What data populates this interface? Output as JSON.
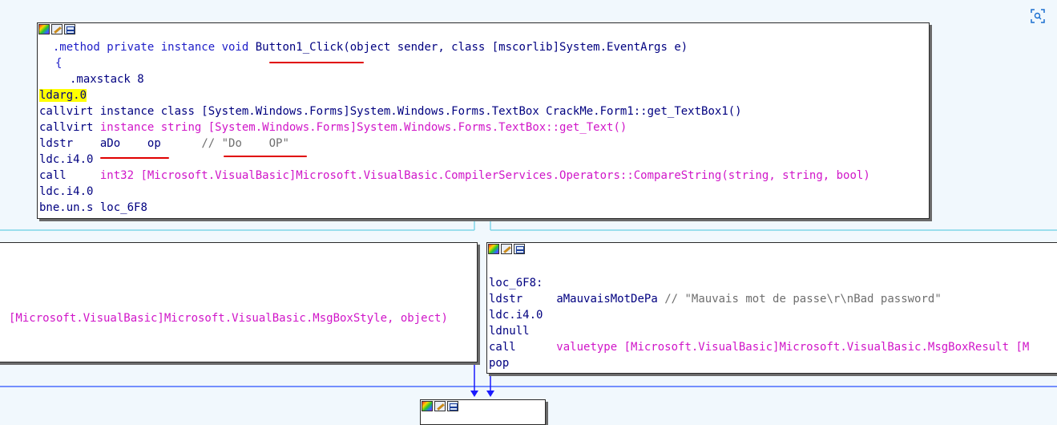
{
  "top_block": {
    "method_decl": ".method private instance void ",
    "method_name": "Button1_Click",
    "method_sig": "(object sender, class [mscorlib]System.EventArgs e)",
    "open_brace": "{",
    "maxstack": ".maxstack 8",
    "instr": [
      {
        "op": "ldarg.0",
        "args": ""
      },
      {
        "op": "callvirt",
        "args": "instance class [System.Windows.Forms]System.Windows.Forms.TextBox CrackMe.Form1::get_TextBox1()"
      },
      {
        "op": "callvirt",
        "pre": "instance string [System.Windows.Forms]",
        "args": "System.Windows.Forms.TextBox::get_Text()"
      },
      {
        "op": "ldstr",
        "args": "aDo",
        "args2": "op",
        "comment": "// \"Do",
        "comment2": "OP\""
      },
      {
        "op": "ldc.i4.0",
        "args": ""
      },
      {
        "op": "call",
        "args": "int32 [Microsoft.VisualBasic]Microsoft.VisualBasic.CompilerServices.Operators::CompareString(string, string, bool)"
      },
      {
        "op": "ldc.i4.0",
        "args": ""
      },
      {
        "op": "bne.un.s",
        "args": "loc_6F8"
      }
    ]
  },
  "left_block": {
    "line": "[Microsoft.VisualBasic]Microsoft.VisualBasic.MsgBoxStyle, object)"
  },
  "right_block": {
    "label": "loc_6F8:",
    "instr": [
      {
        "op": "ldstr",
        "args": "aMauvaisMotDePa",
        "comment": "// \"Mauvais mot de passe\\r\\nBad password\""
      },
      {
        "op": "ldc.i4.0",
        "args": ""
      },
      {
        "op": "ldnull",
        "args": ""
      },
      {
        "op": "call",
        "pre": "valuetype ",
        "args": "[Microsoft.VisualBasic]Microsoft.VisualBasic.MsgBoxResult [M"
      },
      {
        "op": "pop",
        "args": ""
      }
    ]
  },
  "icons": [
    "color-palette-icon",
    "edit-pencil-icon",
    "graph-view-icon",
    "zoom-fit-icon"
  ],
  "colors": {
    "background": "#f1f8fd",
    "keyword": "#0000ff",
    "metadata": "#d016c8",
    "comment": "#6f6f6f",
    "highlight": "#ffff00",
    "edge_blue": "#1a1aff",
    "edge_cyan": "#7fd6e8"
  }
}
